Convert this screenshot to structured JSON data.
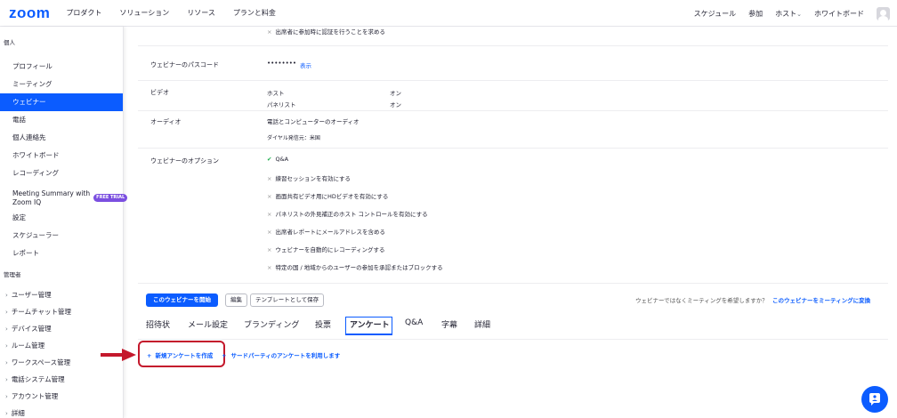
{
  "header": {
    "logo": "zoom",
    "nav": [
      "プロダクト",
      "ソリューション",
      "リソース",
      "プランと料金"
    ],
    "right": [
      "スケジュール",
      "参加",
      "ホスト",
      "ホワイトボード"
    ],
    "host_chevron": "⌄"
  },
  "sidebar": {
    "personal_title": "個人",
    "personal_items": [
      {
        "label": "プロフィール"
      },
      {
        "label": "ミーティング"
      },
      {
        "label": "ウェビナー"
      },
      {
        "label": "電話"
      },
      {
        "label": "個人連絡先"
      },
      {
        "label": "ホワイトボード"
      },
      {
        "label": "レコーディング"
      }
    ],
    "summary_item": {
      "label_line1": "Meeting Summary with",
      "label_line2": "Zoom IQ",
      "badge": "FREE TRIAL"
    },
    "personal_items_after": [
      {
        "label": "設定"
      },
      {
        "label": "スケジューラー"
      },
      {
        "label": "レポート"
      }
    ],
    "admin_title": "管理者",
    "admin_items": [
      {
        "label": "ユーザー管理"
      },
      {
        "label": "チームチャット管理"
      },
      {
        "label": "デバイス管理"
      },
      {
        "label": "ルーム管理"
      },
      {
        "label": "ワークスペース管理"
      },
      {
        "label": "電話システム管理"
      },
      {
        "label": "アカウント管理"
      },
      {
        "label": "詳細"
      }
    ]
  },
  "content": {
    "top_partial": "出席者に参加時に認証を行うことを求める",
    "passcode": {
      "label": "ウェビナーのパスコード",
      "value": "••••••••",
      "link": "表示"
    },
    "video": {
      "label": "ビデオ",
      "host": "ホスト",
      "host_val": "オン",
      "panelist": "パネリスト",
      "panelist_val": "オン"
    },
    "audio": {
      "label": "オーディオ",
      "value": "電話とコンピューターのオーディオ",
      "dial": "ダイヤル発信元：米国"
    },
    "options": {
      "label": "ウェビナーのオプション",
      "checked": "Q&A",
      "items": [
        "練習セッションを有効にする",
        "画面共有ビデオ用にHDビデオを有効にする",
        "パネリストの外見補正のホスト コントロールを有効にする",
        "出席者レポートにメールアドレスを含める",
        "ウェビナーを自動的にレコーディングする",
        "特定の国 / 地域からのユーザーの参加を承認またはブロックする"
      ]
    },
    "actions": {
      "start": "このウェビナーを開始",
      "edit": "編集",
      "template": "テンプレートとして保存",
      "convert_prompt": "ウェビナーではなくミーティングを希望しますか？",
      "convert_link": "このウェビナーをミーティングに変換"
    },
    "tabs": [
      "招待状",
      "メール設定",
      "ブランディング",
      "投票",
      "アンケート",
      "Q&A",
      "字幕",
      "詳細"
    ],
    "active_tab": "アンケート",
    "survey": {
      "plus": "+",
      "create": "新規アンケートを作成",
      "or": "+",
      "third_party": "サードパーティのアンケートを利用します"
    }
  },
  "colors": {
    "brand": "#0b5cff",
    "callout": "#c4182c",
    "check": "#1bae4b"
  }
}
